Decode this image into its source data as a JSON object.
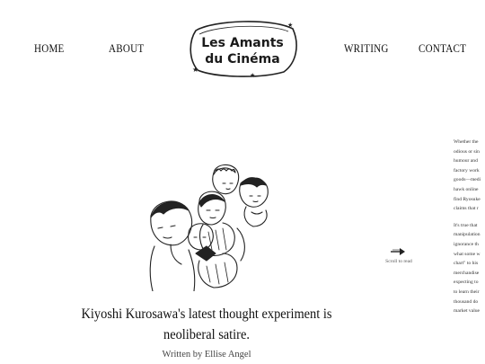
{
  "nav": {
    "home": "HOME",
    "about": "ABOUT",
    "writing": "WRITING",
    "contact": "CONTACT"
  },
  "logo": {
    "line1": "Les Amants",
    "line2": "du Cinéma"
  },
  "hero": {
    "image_icon": "sketch-of-four-figures"
  },
  "article": {
    "headline": "Kiyoshi Kurosawa's latest thought experiment is neoliberal satire.",
    "byline": "Written by Ellise Angel",
    "scroll_label": "Scroll to read",
    "paragraph1": "Whether the\nodious or sin\nhumour and\nfactory work\ngoods—medi\nhawk online\nfind Ryosuke\nclaims that r",
    "paragraph2": "It's true that\nmanipulation\nignorance th\nwhat some w\nchart\" to his\nmerchandise\nexpecting to\nto learn their\nthousand do\nmarket value"
  },
  "colors": {
    "background": "#ffffff",
    "text": "#1a1a1a",
    "ink": "#222222"
  }
}
